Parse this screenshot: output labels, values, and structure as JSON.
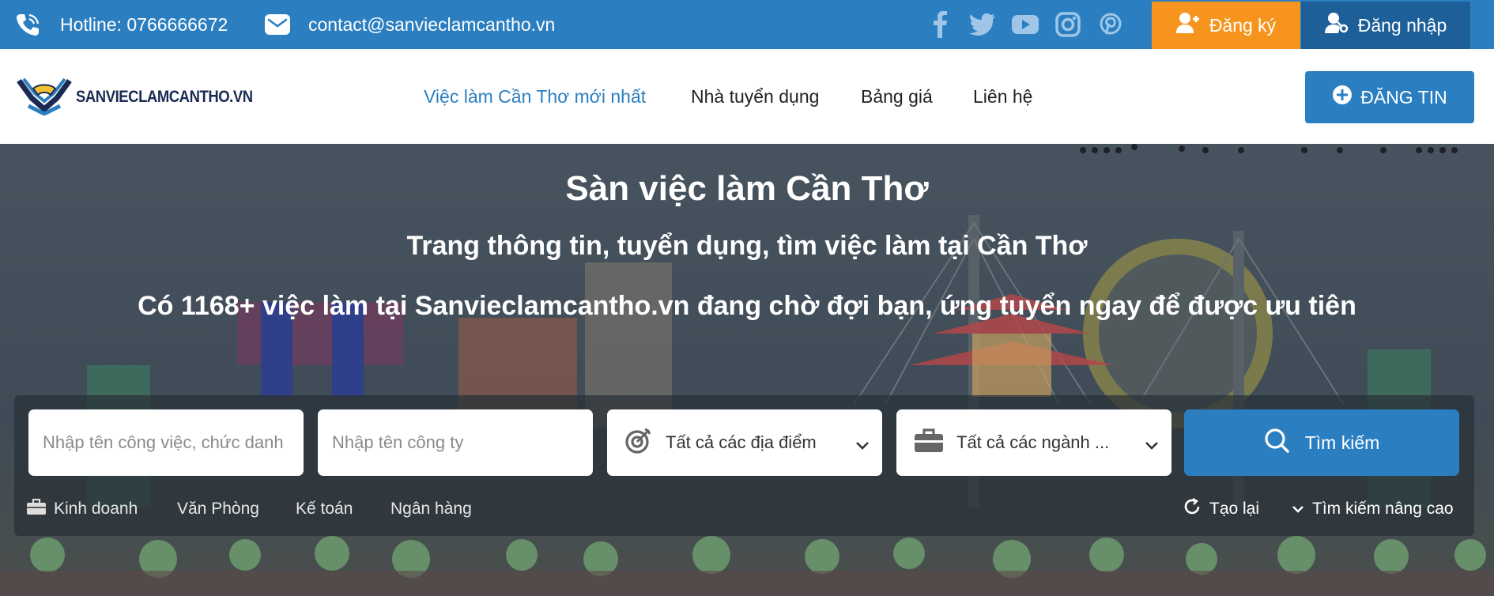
{
  "topbar": {
    "hotline": "Hotline: 0766666672",
    "email": "contact@sanvieclamcantho.vn",
    "social_icons": [
      "facebook-icon",
      "twitter-icon",
      "youtube-icon",
      "instagram-icon",
      "pinterest-icon"
    ],
    "register_label": "Đăng ký",
    "login_label": "Đăng nhập"
  },
  "navbar": {
    "logo_text": "SANVIECLAMCANTHO.VN",
    "items": [
      {
        "label": "Việc làm Cần Thơ mới nhất",
        "active": true
      },
      {
        "label": "Nhà tuyển dụng",
        "active": false
      },
      {
        "label": "Bảng giá",
        "active": false
      },
      {
        "label": "Liên hệ",
        "active": false
      }
    ],
    "post_button_label": "ĐĂNG TIN"
  },
  "hero": {
    "title": "Sàn việc làm Cần Thơ",
    "subtitle": "Trang thông tin, tuyển dụng, tìm việc làm tại Cần Thơ",
    "tagline": "Có 1168+ việc làm tại Sanvieclamcantho.vn đang chờ đợi bạn, ứng tuyển ngay để được ưu tiên"
  },
  "search": {
    "job_placeholder": "Nhập tên công việc, chức danh",
    "company_placeholder": "Nhập tên công ty",
    "location_value": "Tất cả các địa điểm",
    "industry_value": "Tất cả các ngành ...",
    "search_label": "Tìm kiếm",
    "quick_tags": [
      "Kinh doanh",
      "Văn Phòng",
      "Kế toán",
      "Ngân hàng"
    ],
    "reset_label": "Tạo lại",
    "advanced_label": "Tìm kiếm nâng cao"
  },
  "colors": {
    "primary": "#2b7fc1",
    "register": "#f7941d",
    "login": "#1c5f99",
    "hero_overlay": "#3f4b56"
  }
}
